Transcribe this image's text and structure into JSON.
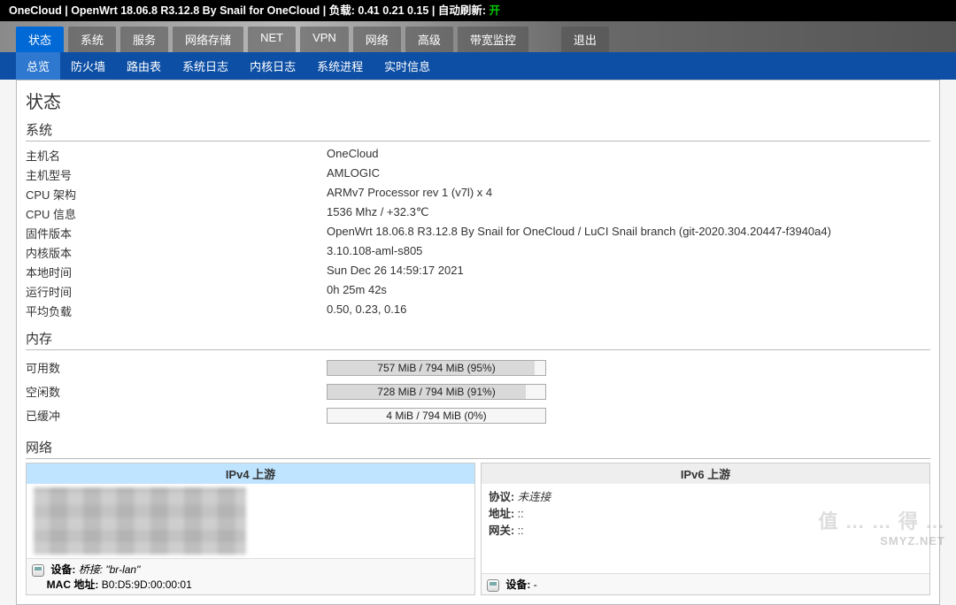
{
  "topbar": {
    "host": "OneCloud",
    "fw": "OpenWrt 18.06.8 R3.12.8 By Snail for OneCloud",
    "load_label": "负载:",
    "load": "0.41 0.21 0.15",
    "refresh_label": "自动刷新:",
    "refresh_state": "开"
  },
  "nav1": {
    "items": [
      "状态",
      "系统",
      "服务",
      "网络存储",
      "NET",
      "VPN",
      "网络",
      "高级",
      "带宽监控",
      "退出"
    ],
    "active": 0,
    "exit_index": 9
  },
  "nav2": {
    "items": [
      "总览",
      "防火墙",
      "路由表",
      "系统日志",
      "内核日志",
      "系统进程",
      "实时信息"
    ],
    "active": 0
  },
  "title": "状态",
  "system": {
    "legend": "系统",
    "rows": [
      {
        "lbl": "主机名",
        "val": "OneCloud"
      },
      {
        "lbl": "主机型号",
        "val": "AMLOGIC"
      },
      {
        "lbl": "CPU 架构",
        "val": "ARMv7 Processor rev 1 (v7l) x 4"
      },
      {
        "lbl": "CPU 信息",
        "val": "1536 Mhz / +32.3℃"
      },
      {
        "lbl": "固件版本",
        "val": "OpenWrt 18.06.8 R3.12.8 By Snail for OneCloud / LuCI Snail branch (git-2020.304.20447-f3940a4)"
      },
      {
        "lbl": "内核版本",
        "val": "3.10.108-aml-s805"
      },
      {
        "lbl": "本地时间",
        "val": "Sun Dec 26 14:59:17 2021"
      },
      {
        "lbl": "运行时间",
        "val": "0h 25m 42s"
      },
      {
        "lbl": "平均负载",
        "val": "0.50, 0.23, 0.16"
      }
    ]
  },
  "memory": {
    "legend": "内存",
    "rows": [
      {
        "lbl": "可用数",
        "txt": "757 MiB / 794 MiB (95%)",
        "pct": 95
      },
      {
        "lbl": "空闲数",
        "txt": "728 MiB / 794 MiB (91%)",
        "pct": 91
      },
      {
        "lbl": "已缓冲",
        "txt": "4 MiB / 794 MiB (0%)",
        "pct": 0
      }
    ]
  },
  "network": {
    "legend": "网络",
    "ipv4": {
      "header": "IPv4 上游",
      "dev_label": "设备:",
      "dev_value": "桥接: \"br-lan\"",
      "mac_label": "MAC 地址:",
      "mac_value": "B0:D5:9D:00:00:01"
    },
    "ipv6": {
      "header": "IPv6 上游",
      "proto_label": "协议:",
      "proto_value": "未连接",
      "addr_label": "地址:",
      "addr_value": "::",
      "gw_label": "网关:",
      "gw_value": "::",
      "dev_label": "设备:",
      "dev_value": "-"
    }
  },
  "watermark": {
    "a": "值 … … 得 …",
    "b": "SMYZ.NET"
  }
}
